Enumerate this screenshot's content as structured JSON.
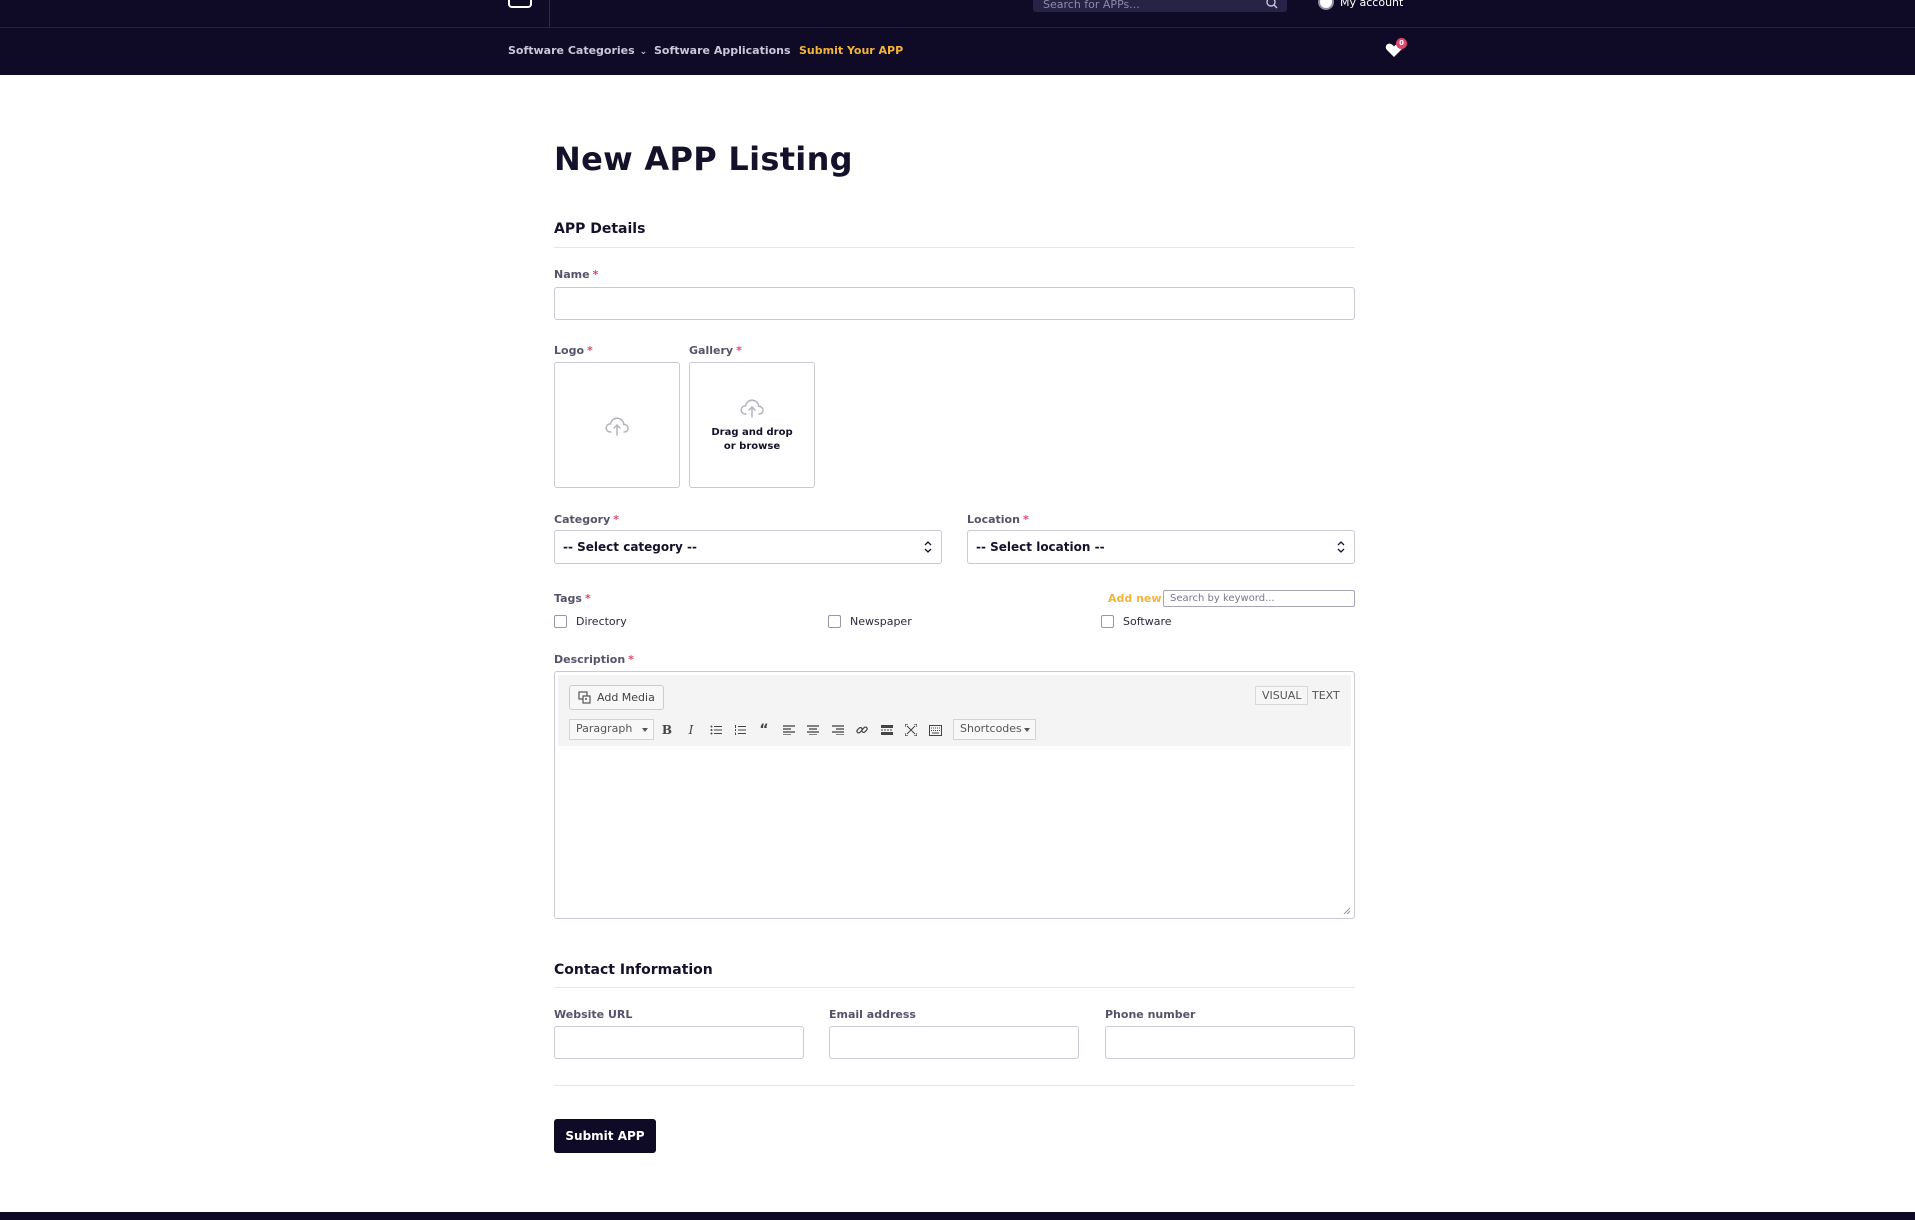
{
  "header": {
    "search_placeholder": "Search for APPs...",
    "account_label": "My account"
  },
  "nav": {
    "items": [
      {
        "label": "Software Categories"
      },
      {
        "label": "Software Applications"
      },
      {
        "label": "Submit Your APP"
      }
    ],
    "wishlist_count": "0"
  },
  "page": {
    "title": "New APP Listing"
  },
  "app_details": {
    "section_title": "APP Details",
    "name_label": "Name",
    "logo_label": "Logo",
    "gallery_label": "Gallery",
    "gallery_hint": "Drag and drop or browse",
    "category_label": "Category",
    "category_value": "-- Select category --",
    "location_label": "Location",
    "location_value": "-- Select location --",
    "tags_label": "Tags",
    "tags_add_new": "Add new",
    "tags_search_placeholder": "Search by keyword...",
    "tags": [
      "Directory",
      "Newspaper",
      "Software"
    ],
    "required_mark": "*"
  },
  "description": {
    "label": "Description",
    "add_media": "Add Media",
    "tab_visual": "VISUAL",
    "tab_text": "TEXT",
    "format": "Paragraph",
    "shortcodes": "Shortcodes"
  },
  "contact": {
    "section_title": "Contact Information",
    "website_label": "Website URL",
    "email_label": "Email address",
    "phone_label": "Phone number"
  },
  "submit_label": "Submit APP",
  "colors": {
    "navy": "#0f0b26",
    "accent": "#f4b43a",
    "required": "#e2456a"
  }
}
